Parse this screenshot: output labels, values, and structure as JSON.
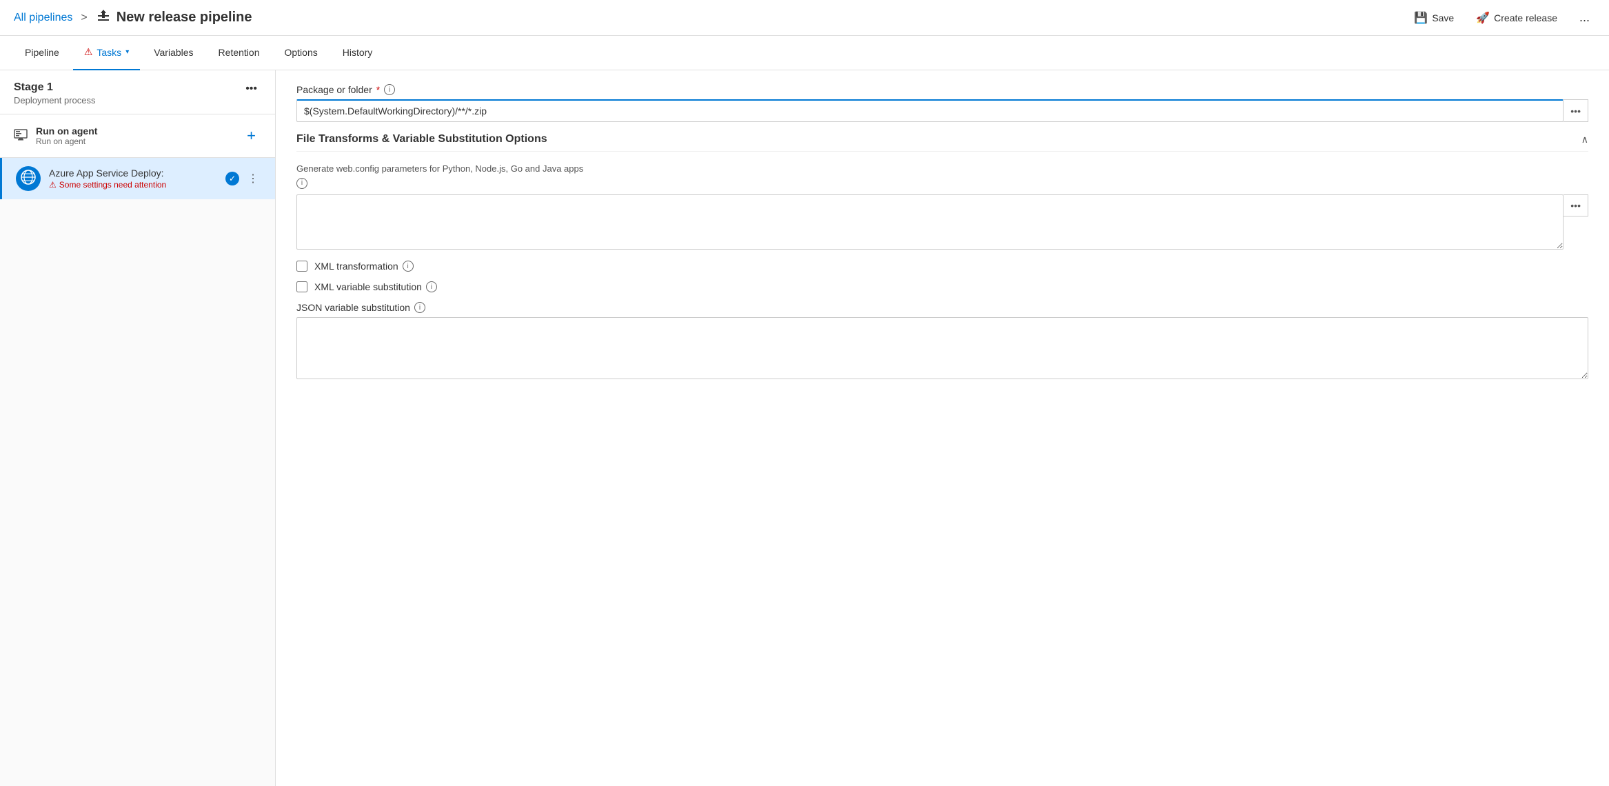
{
  "header": {
    "breadcrumb_link": "All pipelines",
    "breadcrumb_sep": ">",
    "pipeline_title": "New release pipeline",
    "save_label": "Save",
    "create_release_label": "Create release",
    "more_label": "..."
  },
  "nav": {
    "tabs": [
      {
        "id": "pipeline",
        "label": "Pipeline",
        "active": false,
        "warning": false,
        "has_arrow": false
      },
      {
        "id": "tasks",
        "label": "Tasks",
        "active": true,
        "warning": true,
        "has_arrow": true
      },
      {
        "id": "variables",
        "label": "Variables",
        "active": false,
        "warning": false,
        "has_arrow": false
      },
      {
        "id": "retention",
        "label": "Retention",
        "active": false,
        "warning": false,
        "has_arrow": false
      },
      {
        "id": "options",
        "label": "Options",
        "active": false,
        "warning": false,
        "has_arrow": false
      },
      {
        "id": "history",
        "label": "History",
        "active": false,
        "warning": false,
        "has_arrow": false
      }
    ]
  },
  "left_panel": {
    "stage": {
      "title": "Stage 1",
      "subtitle": "Deployment process"
    },
    "agent": {
      "title": "Run on agent",
      "subtitle": "Run on agent"
    },
    "task": {
      "title": "Azure App Service Deploy:",
      "warning": "Some settings need attention"
    }
  },
  "right_panel": {
    "package_label": "Package or folder",
    "package_value": "$(System.DefaultWorkingDirectory)/**/*.zip",
    "section_title": "File Transforms & Variable Substitution Options",
    "generate_desc": "Generate web.config parameters for Python, Node.js, Go and Java apps",
    "xml_transform_label": "XML transformation",
    "xml_substitute_label": "XML variable substitution",
    "json_substitute_label": "JSON variable substitution"
  }
}
